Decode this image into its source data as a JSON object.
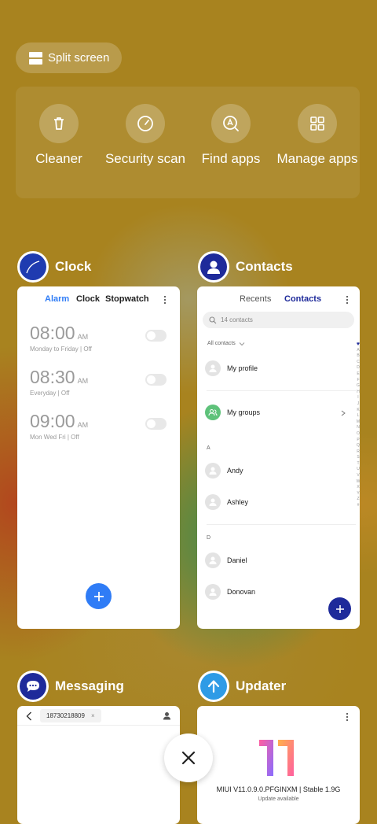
{
  "split_screen": {
    "label": "Split screen"
  },
  "quick_actions": [
    {
      "label": "Cleaner",
      "icon": "trash-icon"
    },
    {
      "label": "Security scan",
      "icon": "gauge-icon"
    },
    {
      "label": "Find apps",
      "icon": "search-apps-icon"
    },
    {
      "label": "Manage apps",
      "icon": "grid-icon"
    }
  ],
  "clock": {
    "title": "Clock",
    "tabs": [
      "Alarm",
      "Clock",
      "Stopwatch"
    ],
    "alarms": [
      {
        "time": "08:00",
        "ampm": "AM",
        "desc": "Monday to Friday | Off"
      },
      {
        "time": "08:30",
        "ampm": "AM",
        "desc": "Everyday | Off"
      },
      {
        "time": "09:00",
        "ampm": "AM",
        "desc": "Mon Wed Fri | Off"
      }
    ],
    "accent": "#2f7cf6"
  },
  "contacts": {
    "title": "Contacts",
    "tabs": [
      "Recents",
      "Contacts"
    ],
    "search_placeholder": "14 contacts",
    "filter": "All contacts",
    "my_profile": "My profile",
    "my_groups": "My groups",
    "section_a": "A",
    "section_d": "D",
    "names": [
      "Andy",
      "Ashley",
      "Daniel",
      "Donovan"
    ],
    "index_letters": [
      "A",
      "B",
      "C",
      "D",
      "E",
      "F",
      "G",
      "H",
      "I",
      "J",
      "K",
      "L",
      "M",
      "N",
      "O",
      "P",
      "Q",
      "R",
      "S",
      "T",
      "U",
      "V",
      "W",
      "X",
      "Y",
      "Z",
      "#"
    ],
    "accent": "#1e2a9a"
  },
  "messaging": {
    "title": "Messaging",
    "recipient": "18730218809"
  },
  "updater": {
    "title": "Updater",
    "version": "MIUI V11.0.9.0.PFGINXM | Stable 1.9G",
    "status": "Update available"
  }
}
